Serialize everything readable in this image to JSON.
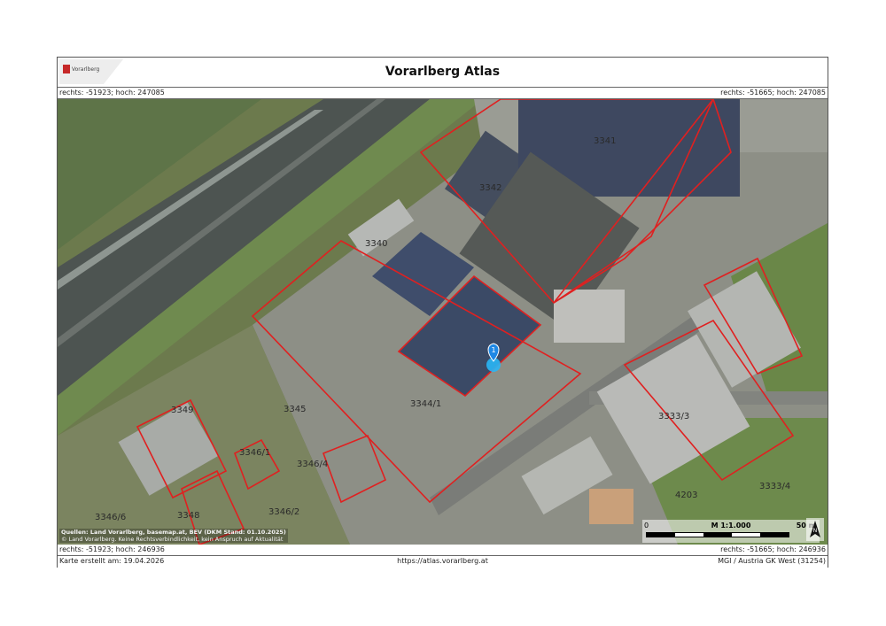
{
  "header": {
    "title": "Vorarlberg Atlas",
    "logo_text": "Vorarlberg"
  },
  "coords_top": {
    "left": "rechts: -51923; hoch: 247085",
    "right": "rechts: -51665; hoch: 247085"
  },
  "coords_bottom": {
    "left": "rechts: -51923; hoch: 246936",
    "right": "rechts: -51665; hoch: 246936"
  },
  "footer": {
    "created": "Karte erstellt am: 19.04.2026",
    "url": "https://atlas.vorarlberg.at",
    "crs": "MGI / Austria GK West (31254)"
  },
  "map": {
    "sources_line1": "Quellen: Land Vorarlberg, basemap.at, BEV (DKM Stand: 01.10.2025)",
    "sources_line2": "© Land Vorarlberg. Keine Rechtsverbindlichkeit, kein Anspruch auf Aktualität",
    "marker_number": "1",
    "parcels": [
      "3344/1",
      "3345",
      "3349",
      "3346/1",
      "3346/4",
      "3348",
      "3346/2",
      "3333/3",
      "4203",
      "3333/4",
      "3341",
      "3342",
      "3340",
      "3346/6"
    ],
    "colors": {
      "parcel_outline": "#e02020",
      "marker": "#1e88e5",
      "marker_ring": "#29b6f6"
    }
  },
  "scale": {
    "zero": "0",
    "ratio": "M 1:1.000",
    "end": "50 m"
  }
}
